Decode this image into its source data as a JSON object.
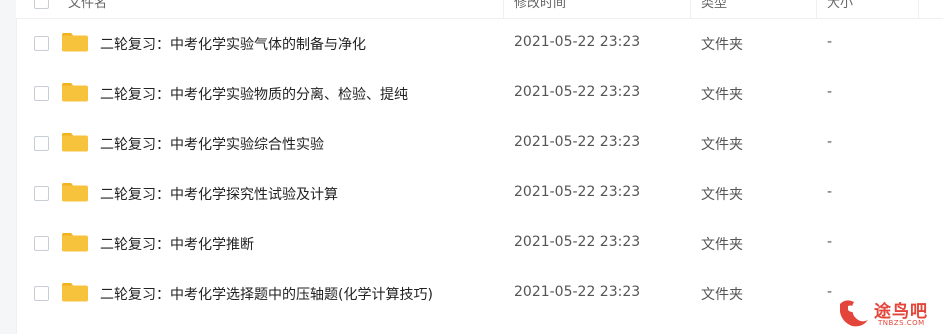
{
  "header": {
    "name_label": "文件名",
    "modified_label": "修改时间",
    "type_label": "类型",
    "size_label": "大小"
  },
  "files": [
    {
      "name": "二轮复习：中考化学实验气体的制备与净化",
      "modified": "2021-05-22 23:23",
      "type": "文件夹",
      "size": "-"
    },
    {
      "name": "二轮复习：中考化学实验物质的分离、检验、提纯",
      "modified": "2021-05-22 23:23",
      "type": "文件夹",
      "size": "-"
    },
    {
      "name": "二轮复习：中考化学实验综合性实验",
      "modified": "2021-05-22 23:23",
      "type": "文件夹",
      "size": "-"
    },
    {
      "name": "二轮复习：中考化学探究性试验及计算",
      "modified": "2021-05-22 23:23",
      "type": "文件夹",
      "size": "-"
    },
    {
      "name": "二轮复习：中考化学推断",
      "modified": "2021-05-22 23:23",
      "type": "文件夹",
      "size": "-"
    },
    {
      "name": "二轮复习：中考化学选择题中的压轴题(化学计算技巧)",
      "modified": "2021-05-22 23:23",
      "type": "文件夹",
      "size": "-"
    }
  ],
  "watermark": {
    "text_cn": "途鸟吧",
    "text_en": "TNBZS.COM"
  },
  "colors": {
    "folder": "#f7c23c",
    "folder_tab": "#f0b321",
    "accent": "#3b8cff",
    "watermark": "#e4453a"
  },
  "icons": {
    "folder": "folder-icon",
    "sort": "sort-desc-icon",
    "logo": "tnbz-logo-icon"
  }
}
